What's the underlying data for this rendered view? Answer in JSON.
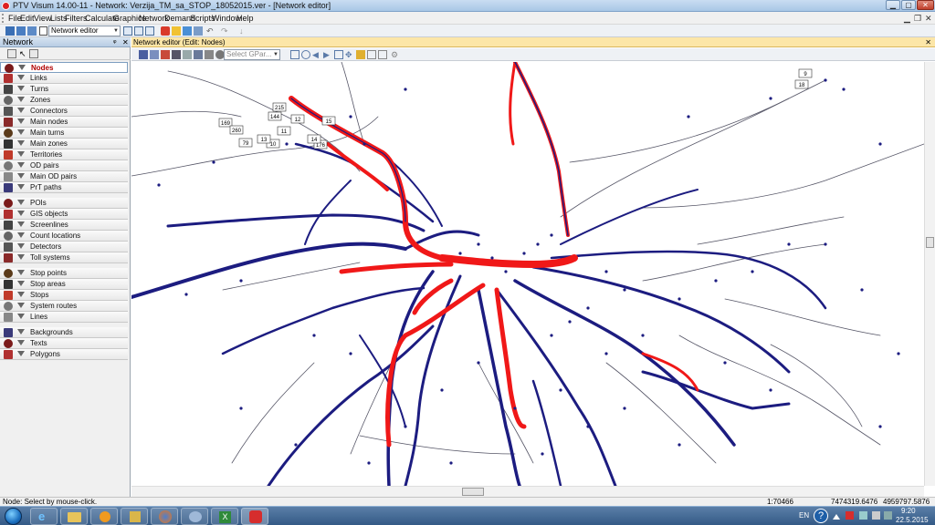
{
  "window": {
    "title": "PTV Visum 14.00-11 - Network: Verzija_TM_sa_STOP_18052015.ver - [Network editor]",
    "min_label": "▁",
    "max_label": "▢",
    "close_label": "✕"
  },
  "menu": {
    "items": [
      "File",
      "Edit",
      "View",
      "Lists",
      "Filters",
      "Calculate",
      "Graphics",
      "Network",
      "Demand",
      "Scripts",
      "Window",
      "Help"
    ],
    "mdi_min": "▁",
    "mdi_restore": "❐",
    "mdi_close": "✕"
  },
  "toolbar": {
    "mode_combo": "Network editor"
  },
  "network_panel": {
    "title": "Network",
    "pin_label": "ᵠ",
    "close_label": "✕",
    "groups": [
      [
        {
          "label": "Nodes",
          "icon": "node-icon",
          "selected": true
        },
        {
          "label": "Links",
          "icon": "link-icon"
        },
        {
          "label": "Turns",
          "icon": "turn-icon"
        },
        {
          "label": "Zones",
          "icon": "zone-icon"
        },
        {
          "label": "Connectors",
          "icon": "connector-icon"
        },
        {
          "label": "Main nodes",
          "icon": "main-node-icon"
        },
        {
          "label": "Main turns",
          "icon": "main-turn-icon"
        },
        {
          "label": "Main zones",
          "icon": "main-zone-icon"
        },
        {
          "label": "Territories",
          "icon": "territory-icon"
        },
        {
          "label": "OD pairs",
          "icon": "od-pair-icon"
        },
        {
          "label": "Main OD pairs",
          "icon": "main-od-pair-icon"
        },
        {
          "label": "PrT paths",
          "icon": "prt-path-icon"
        }
      ],
      [
        {
          "label": "POIs",
          "icon": "poi-icon"
        },
        {
          "label": "GIS objects",
          "icon": "gis-object-icon"
        },
        {
          "label": "Screenlines",
          "icon": "screenline-icon"
        },
        {
          "label": "Count locations",
          "icon": "count-location-icon"
        },
        {
          "label": "Detectors",
          "icon": "detector-icon"
        },
        {
          "label": "Toll systems",
          "icon": "toll-system-icon"
        }
      ],
      [
        {
          "label": "Stop points",
          "icon": "stop-point-icon"
        },
        {
          "label": "Stop areas",
          "icon": "stop-area-icon"
        },
        {
          "label": "Stops",
          "icon": "stop-icon"
        },
        {
          "label": "System routes",
          "icon": "system-route-icon"
        },
        {
          "label": "Lines",
          "icon": "line-icon"
        }
      ],
      [
        {
          "label": "Backgrounds",
          "icon": "background-icon"
        },
        {
          "label": "Texts",
          "icon": "text-icon"
        },
        {
          "label": "Polygons",
          "icon": "polygon-icon"
        }
      ]
    ]
  },
  "editor": {
    "title": "Network editor (Edit: Nodes)",
    "close_label": "✕",
    "gpar_combo": "Select GPar...",
    "map_labels": [
      "9",
      "18",
      "169",
      "176",
      "144",
      "215",
      "260",
      "79",
      "10",
      "11",
      "12",
      "13",
      "14",
      "15"
    ]
  },
  "status": {
    "hint": "Node: Select by mouse-click.",
    "scale": "1:70466",
    "x": "7474319.6476",
    "y": "4959797.5876"
  },
  "taskbar": {
    "lang": "EN",
    "time": "9:20",
    "date": "22.5.2015",
    "help_glyph": "?"
  },
  "colors": {
    "network_blue": "#1c1c80",
    "volume_red": "#f01818",
    "thin_link": "#555566",
    "selection_red": "#b00000"
  }
}
